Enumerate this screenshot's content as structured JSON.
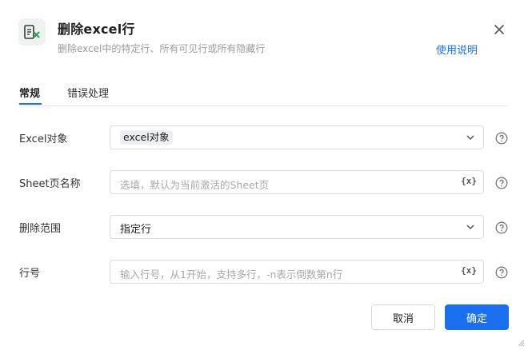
{
  "header": {
    "title": "删除excel行",
    "subtitle": "删除excel中的特定行、所有可见行或所有隐藏行",
    "help_link": "使用说明"
  },
  "tabs": [
    {
      "label": "常规",
      "active": true
    },
    {
      "label": "错误处理",
      "active": false
    }
  ],
  "form": {
    "excel_object": {
      "label": "Excel对象",
      "value": "excel对象"
    },
    "sheet_name": {
      "label": "Sheet页名称",
      "placeholder": "选填，默认为当前激活的Sheet页",
      "var_button": "{x}"
    },
    "delete_range": {
      "label": "删除范围",
      "value": "指定行"
    },
    "row_number": {
      "label": "行号",
      "placeholder": "输入行号，从1开始，支持多行，-n表示倒数第n行",
      "var_button": "{x}"
    }
  },
  "footer": {
    "cancel_label": "取消",
    "ok_label": "确定"
  },
  "colors": {
    "accent": "#1a73e8",
    "primary_button": "#1a6ff0",
    "icon_green": "#2e9d5a"
  },
  "icons": [
    "excel-delete-icon",
    "close-icon",
    "chevron-down-icon",
    "help-circle-icon",
    "variable-icon",
    "resize-grip-icon"
  ]
}
